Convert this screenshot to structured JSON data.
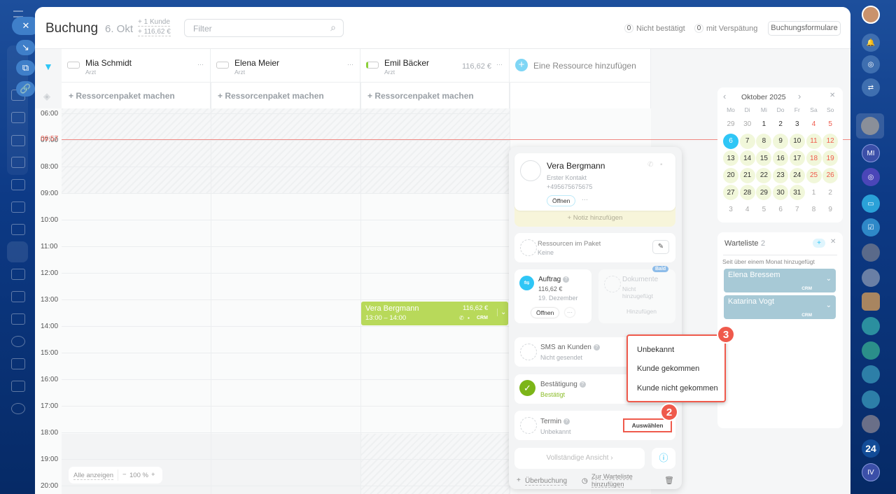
{
  "header": {
    "title": "Buchung",
    "date": "6. Okt",
    "stat_clients": "+ 1 Kunde",
    "stat_sum": "+ 116,62 €",
    "filter_placeholder": "Filter",
    "unconfirmed_count": "0",
    "unconfirmed_label": "Nicht bestätigt",
    "late_count": "0",
    "late_label": "mit Verspätung",
    "forms_button": "Buchungsformulare"
  },
  "resources": [
    {
      "name": "Mia Schmidt",
      "role": "Arzt",
      "amount": "",
      "more": "···"
    },
    {
      "name": "Elena Meier",
      "role": "Arzt",
      "amount": "",
      "more": "···"
    },
    {
      "name": "Emil Bäcker",
      "role": "Arzt",
      "amount": "116,62 €",
      "more": "···"
    }
  ],
  "add_resource": "Eine Ressource hinzufügen",
  "pack_label": "+ Ressorcenpaket machen",
  "now_time": "06:57",
  "times": [
    "06:00",
    "07:00",
    "08:00",
    "09:00",
    "10:00",
    "11:00",
    "12:00",
    "13:00",
    "14:00",
    "15:00",
    "16:00",
    "17:00",
    "18:00",
    "19:00",
    "20:00"
  ],
  "booking": {
    "name": "Vera Bergmann",
    "time": "13:00 – 14:00",
    "amount": "116,62 €",
    "crm": "CRM"
  },
  "zoom": {
    "show_all": "Alle anzeigen",
    "minus": "−",
    "level": "100 %",
    "plus": "+"
  },
  "popup": {
    "client_name": "Vera Bergmann",
    "client_sub": "Erster Kontakt",
    "client_phone": "+495675675675",
    "open": "Öffnen",
    "more": "···",
    "add_note": "+ Notiz hinzufügen",
    "pkg_title": "Ressourcen im Paket",
    "pkg_value": "Keine",
    "order_title": "Auftrag",
    "order_amount": "116,62 €",
    "order_date": "19. Dezember",
    "order_open": "Öffnen",
    "docs_badge": "Bald",
    "docs_title": "Dokumente",
    "docs_value": "Nicht hinzugefügt",
    "docs_add": "Hinzufügen",
    "sms_title": "SMS an Kunden",
    "sms_value": "Nicht gesendet",
    "confirm_title": "Bestätigung",
    "confirm_value": "Bestätigt",
    "term_title": "Termin",
    "term_value": "Unbekannt",
    "term_select": "Auswählen",
    "full_view": "Vollständige Ansicht ›",
    "overbooking": "Überbuchung",
    "waitlist_add": "Zur Warteliste hinzufügen"
  },
  "dropdown": {
    "options": [
      "Unbekannt",
      "Kunde gekommen",
      "Kunde nicht gekommen"
    ]
  },
  "badges": {
    "step2": "2",
    "step3": "3"
  },
  "calendar": {
    "month": "Oktober 2025",
    "weekdays": [
      "Mo",
      "Di",
      "Mi",
      "Do",
      "Fr",
      "Sa",
      "So"
    ],
    "days": [
      "29",
      "30",
      "1",
      "2",
      "3",
      "4",
      "5",
      "6",
      "7",
      "8",
      "9",
      "10",
      "11",
      "12",
      "13",
      "14",
      "15",
      "16",
      "17",
      "18",
      "19",
      "20",
      "21",
      "22",
      "23",
      "24",
      "25",
      "26",
      "27",
      "28",
      "29",
      "30",
      "31",
      "1",
      "2",
      "3",
      "4",
      "5",
      "6",
      "7",
      "8",
      "9"
    ],
    "selected": "6"
  },
  "waitlist": {
    "title": "Warteliste",
    "count": "2",
    "group": "Seit über einem Monat hinzugefügt",
    "items": [
      "Elena Bressem",
      "Katarina Vogt"
    ],
    "crm": "CRM"
  },
  "right_sidebar": {
    "mi": "MI",
    "b24": "24",
    "iv": "IV"
  },
  "colors": {
    "accent": "#2fc6f6",
    "booking": "#b8d95a",
    "danger": "#ef5a4c",
    "now": "#f08a84"
  }
}
